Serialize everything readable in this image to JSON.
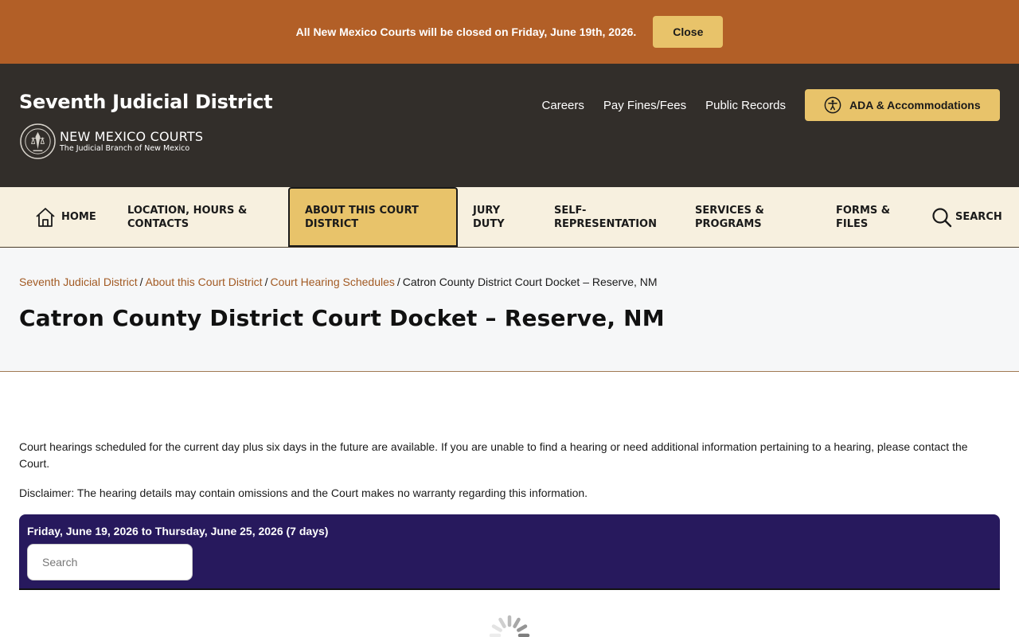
{
  "alert": {
    "message": "All New Mexico Courts will be closed on Friday, June 19th, 2026.",
    "close_label": "Close"
  },
  "header": {
    "site_title": "Seventh Judicial District",
    "brand_name": "NEW MEXICO COURTS",
    "brand_tagline": "The Judicial Branch of New Mexico",
    "utility_links": [
      "Careers",
      "Pay Fines/Fees",
      "Public Records"
    ],
    "ada_label": "ADA & Accommodations"
  },
  "nav": {
    "home": "HOME",
    "location_line1": "LOCATION, HOURS &",
    "location_line2": "CONTACTS",
    "about_line1": "ABOUT THIS COURT",
    "about_line2": "DISTRICT",
    "jury_line1": "JURY",
    "jury_line2": "DUTY",
    "self_line1": "SELF-",
    "self_line2": "REPRESENTATION",
    "services_line1": "SERVICES &",
    "services_line2": "PROGRAMS",
    "forms_line1": "FORMS &",
    "forms_line2": "FILES",
    "search": "SEARCH"
  },
  "breadcrumb": {
    "items": [
      "Seventh Judicial District",
      "About this Court District",
      "Court Hearing Schedules"
    ],
    "separator": "/",
    "current": "Catron County District Court Docket – Reserve, NM"
  },
  "page": {
    "title": "Catron County District Court Docket – Reserve, NM",
    "intro": "Court hearings scheduled for the current day plus six days in the future are available. If you are unable to find a hearing or need additional information pertaining to a hearing, please contact the Court.",
    "disclaimer": "Disclaimer:  The hearing details may contain omissions and the Court makes no warranty regarding this information."
  },
  "docket": {
    "date_range": "Friday, June 19, 2026 to Thursday, June 25, 2026 (7 days)",
    "search_placeholder": "Search"
  },
  "colors": {
    "alert_bg": "#b25f27",
    "header_bg": "#322e2a",
    "accent": "#e8c36a",
    "nav_bg": "#f7f0df",
    "link": "#a25a23",
    "docket_bg": "#27195d"
  }
}
